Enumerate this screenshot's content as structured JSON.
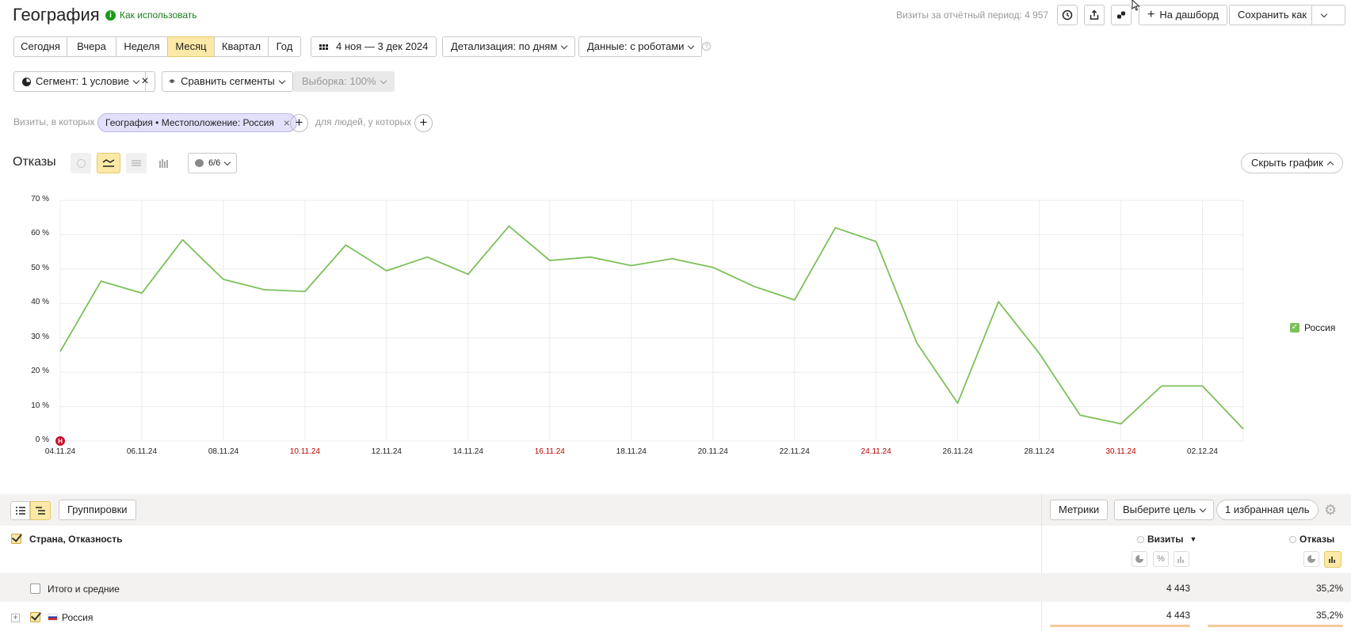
{
  "header": {
    "title": "География",
    "how_to_use": "Как использовать",
    "visits_summary": "Визиты за отчётный период: 4 957",
    "dashboard_label": "На дашборд",
    "save_as_label": "Сохранить как"
  },
  "periods": [
    "Сегодня",
    "Вчера",
    "Неделя",
    "Месяц",
    "Квартал",
    "Год"
  ],
  "active_period": "Месяц",
  "date_range": "4 ноя — 3 дек 2024",
  "detail": "Детализация: по дням",
  "data_mode": "Данные: с роботами",
  "segment": {
    "label": "Сегмент: 1 условие",
    "compare": "Сравнить сегменты",
    "sample": "Выборка: 100%"
  },
  "filter": {
    "visits_prefix": "Визиты, в которых",
    "chip": "География • Местоположение: Россия",
    "people_prefix": "для людей, у которых"
  },
  "chart_header": {
    "metric": "Отказы",
    "annotations": "6/6",
    "hide_chart": "Скрыть график"
  },
  "chart_data": {
    "type": "line",
    "title": "",
    "ylim": [
      0,
      70
    ],
    "y_ticks": [
      "70 %",
      "60 %",
      "50 %",
      "40 %",
      "30 %",
      "20 %",
      "10 %",
      "0 %"
    ],
    "x_ticks": [
      {
        "label": "04.11.24",
        "index": 0,
        "weekend": false
      },
      {
        "label": "06.11.24",
        "index": 2,
        "weekend": false
      },
      {
        "label": "08.11.24",
        "index": 4,
        "weekend": false
      },
      {
        "label": "10.11.24",
        "index": 6,
        "weekend": true
      },
      {
        "label": "12.11.24",
        "index": 8,
        "weekend": false
      },
      {
        "label": "14.11.24",
        "index": 10,
        "weekend": false
      },
      {
        "label": "16.11.24",
        "index": 12,
        "weekend": true
      },
      {
        "label": "18.11.24",
        "index": 14,
        "weekend": false
      },
      {
        "label": "20.11.24",
        "index": 16,
        "weekend": false
      },
      {
        "label": "22.11.24",
        "index": 18,
        "weekend": false
      },
      {
        "label": "24.11.24",
        "index": 20,
        "weekend": true
      },
      {
        "label": "26.11.24",
        "index": 22,
        "weekend": false
      },
      {
        "label": "28.11.24",
        "index": 24,
        "weekend": false
      },
      {
        "label": "30.11.24",
        "index": 26,
        "weekend": true
      },
      {
        "label": "02.12.24",
        "index": 28,
        "weekend": false
      }
    ],
    "series": [
      {
        "name": "Россия",
        "color": "#7cc05a",
        "values": [
          26,
          46.5,
          43,
          58.5,
          47,
          44,
          43.5,
          57,
          49.5,
          53.5,
          48.5,
          62.5,
          52.5,
          53.5,
          51,
          53,
          50.5,
          45,
          41,
          62,
          58,
          28.5,
          11,
          40.5,
          25.5,
          7.5,
          5,
          16,
          16,
          3.5
        ]
      }
    ],
    "marker_letter": "Н"
  },
  "table": {
    "groupings_label": "Группировки",
    "metrics_label": "Метрики",
    "goal_label": "Выберите цель",
    "fav_goal_label": "1 избранная цель",
    "dimension_header": "Страна, Отказность",
    "col_visits": "Визиты",
    "col_bounces": "Отказы",
    "totals_label": "Итого и средние",
    "totals_visits": "4 443",
    "totals_bounces": "35,2%",
    "rows": [
      {
        "name": "Россия",
        "visits": "4 443",
        "bounces": "35,2%"
      }
    ]
  }
}
